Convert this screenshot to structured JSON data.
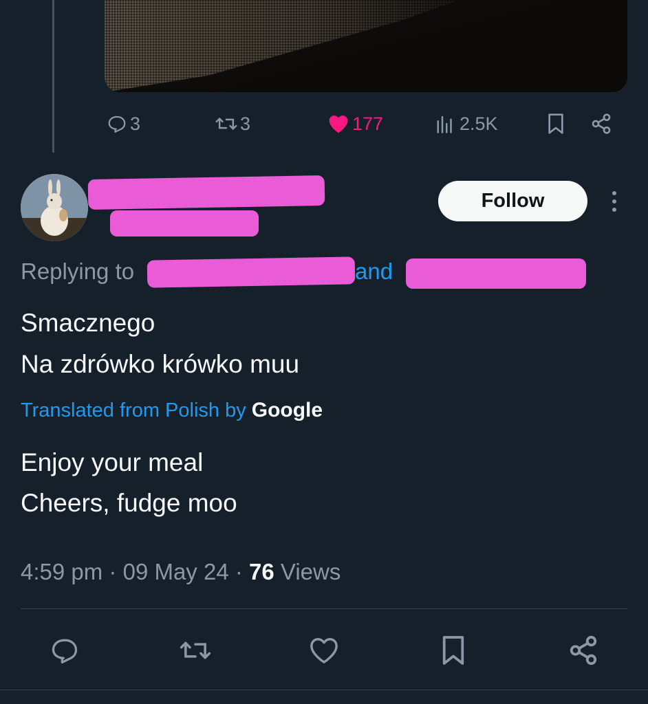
{
  "parent_tweet": {
    "actions": {
      "reply_count": "3",
      "retweet_count": "3",
      "like_count": "177",
      "view_count": "2.5K"
    }
  },
  "reply": {
    "follow_label": "Follow",
    "replying_prefix": "Replying to",
    "replying_and": "and",
    "text_lines": [
      "Smacznego",
      "Na zdrówko krówko muu"
    ],
    "translated_label": "Translated from Polish by",
    "translated_brand": "Google",
    "translation_lines": [
      "Enjoy your meal",
      "Cheers, fudge moo"
    ],
    "time": "4:59 pm",
    "date": "09 May 24",
    "views_count": "76",
    "views_label": "Views",
    "separator": "·"
  },
  "colors": {
    "background": "#15202b",
    "accent": "#1d9bf0",
    "like": "#f91880",
    "muted": "#8b98a5",
    "redaction": "#ea5bd7"
  }
}
